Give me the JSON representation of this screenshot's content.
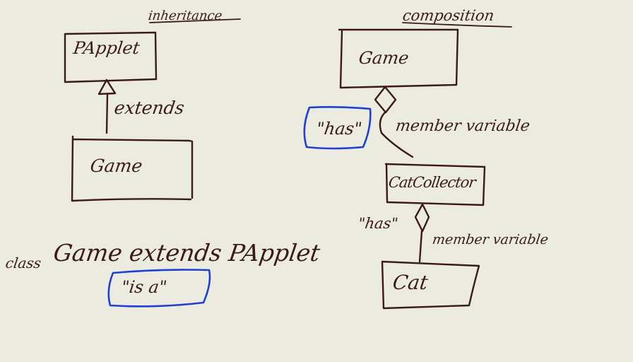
{
  "inheritance": {
    "heading": "inheritance",
    "superclass": "PApplet",
    "relation": "extends",
    "subclass": "Game",
    "code": "class Game extends PApplet",
    "code_keyword": "class",
    "code_rest": "Game extends PApplet",
    "note": "\"is a\""
  },
  "composition": {
    "heading": "composition",
    "outer": "Game",
    "middle": "CatCollector",
    "inner": "Cat",
    "note_top": "\"has\"",
    "relation_top": "member variable",
    "note_bottom": "\"has\"",
    "relation_bottom": "member variable"
  },
  "colors": {
    "ink": "#3a1c14",
    "highlight": "#1f3fd6",
    "paper": "#ecebe0"
  }
}
